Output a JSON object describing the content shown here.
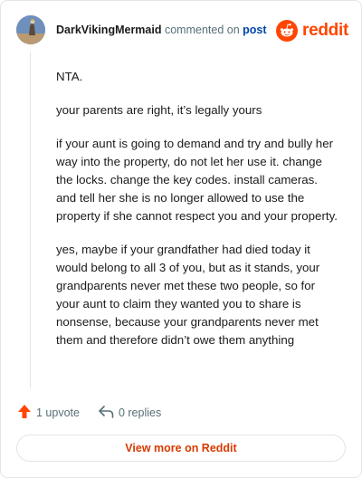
{
  "header": {
    "author": "DarkVikingMermaid",
    "commented_text": "commented on",
    "post_link": "post",
    "logo_text": "reddit",
    "avatar_icon": "user-avatar",
    "logo_icon": "reddit-snoo-icon"
  },
  "comment": {
    "paragraphs": [
      "NTA.",
      "your parents are right, it’s legally yours",
      "if your aunt is going to demand and try and bully her way into the property, do not let her use it. change the locks. change the key codes. install cameras. and tell her she is no longer allowed to use the property if she cannot respect you and your property.",
      "yes, maybe if your grandfather had died today it would belong to all 3 of you, but as it stands, your grandparents never met these two people, so for your aunt to claim they wanted you to share is nonsense, because your grandparents never met them and therefore didn’t owe them anything"
    ]
  },
  "actions": {
    "upvote_label": "1 upvote",
    "upvote_icon": "upvote-arrow-icon",
    "replies_label": "0 replies",
    "replies_icon": "reply-arrow-icon"
  },
  "footer": {
    "view_more_label": "View more on Reddit"
  },
  "colors": {
    "brand": "#ff4500",
    "link": "#0045ac",
    "muted": "#576f76",
    "view_more": "#d93a00"
  }
}
